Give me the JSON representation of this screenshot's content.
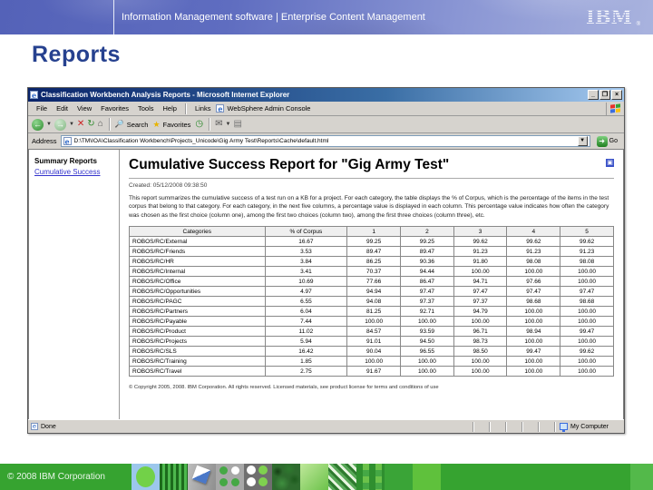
{
  "slide": {
    "header": {
      "brand": "Information Management software | Enterprise Content Management",
      "logo": "IBM",
      "logo_reg": "®"
    },
    "title": "Reports",
    "footer_copyright": "© 2008 IBM Corporation"
  },
  "browser": {
    "window_title": "Classification Workbench Analysis Reports - Microsoft Internet Explorer",
    "window_buttons": {
      "minimize": "_",
      "maximize": "❐",
      "close": "×"
    },
    "menus": [
      "File",
      "Edit",
      "View",
      "Favorites",
      "Tools",
      "Help"
    ],
    "links_label": "Links",
    "links_item": "WebSphere Admin Console",
    "toolbar": {
      "back": "←",
      "forward": "→",
      "stop": "✕",
      "refresh": "↻",
      "home": "⌂",
      "search_label": "Search",
      "favorites_label": "Favorites",
      "history": "◷",
      "mail": "✉",
      "print": "▤"
    },
    "address": {
      "label": "Address",
      "url": "D:\\TM\\IOA\\Classification Workbench\\Projects_Unicode\\Gig Army Test\\Reports\\Cache\\default.html",
      "go_label": "Go"
    },
    "status": {
      "left": "Done",
      "right": "My Computer"
    }
  },
  "report": {
    "sidebar": {
      "heading": "Summary Reports",
      "link": "Cumulative Success"
    },
    "heading": "Cumulative Success Report for \"Gig Army Test\"",
    "created": "Created:  05/12/2008 09:38:50",
    "description": "This report summarizes the cumulative success of a test run on a KB for a project. For each category, the table displays the % of Corpus, which is the percentage of the items in the test corpus that belong to that category. For each category, in the next five columns, a percentage value is displayed in each column. This percentage value indicates how often the category was chosen as the first choice (column one), among the first two choices (column two), among the first three choices (column three), etc.",
    "table": {
      "headers": [
        "Categories",
        "% of Corpus",
        "1",
        "2",
        "3",
        "4",
        "5"
      ],
      "rows": [
        [
          "ROBOS/RC/External",
          "16.67",
          "99.25",
          "99.25",
          "99.62",
          "99.62",
          "99.62"
        ],
        [
          "ROBOS/RC/Friends",
          "3.53",
          "89.47",
          "89.47",
          "91.23",
          "91.23",
          "91.23"
        ],
        [
          "ROBOS/RC/HR",
          "3.84",
          "86.25",
          "90.36",
          "91.80",
          "98.08",
          "98.08"
        ],
        [
          "ROBOS/RC/Internal",
          "3.41",
          "70.37",
          "94.44",
          "100.00",
          "100.00",
          "100.00"
        ],
        [
          "ROBOS/RC/Office",
          "10.69",
          "77.66",
          "86.47",
          "94.71",
          "97.66",
          "100.00"
        ],
        [
          "ROBOS/RC/Opportunities",
          "4.97",
          "94.94",
          "97.47",
          "97.47",
          "97.47",
          "97.47"
        ],
        [
          "ROBOS/RC/PAGC",
          "6.55",
          "94.08",
          "97.37",
          "97.37",
          "98.68",
          "98.68"
        ],
        [
          "ROBOS/RC/Partners",
          "6.04",
          "81.25",
          "92.71",
          "94.79",
          "100.00",
          "100.00"
        ],
        [
          "ROBOS/RC/Payable",
          "7.44",
          "100.00",
          "100.00",
          "100.00",
          "100.00",
          "100.00"
        ],
        [
          "ROBOS/RC/Product",
          "11.02",
          "84.57",
          "93.59",
          "96.71",
          "98.94",
          "99.47"
        ],
        [
          "ROBOS/RC/Projects",
          "5.94",
          "91.01",
          "94.50",
          "98.73",
          "100.00",
          "100.00"
        ],
        [
          "ROBOS/RC/SLS",
          "16.42",
          "90.04",
          "96.55",
          "98.50",
          "99.47",
          "99.62"
        ],
        [
          "ROBOS/RC/Training",
          "1.85",
          "100.00",
          "100.00",
          "100.00",
          "100.00",
          "100.00"
        ],
        [
          "ROBOS/RC/Travel",
          "2.75",
          "91.67",
          "100.00",
          "100.00",
          "100.00",
          "100.00"
        ]
      ]
    },
    "copyright": "© Copyright 2005, 2008. IBM Corporation. All rights reserved. Licensed materials, see product license for terms and conditions of use"
  }
}
